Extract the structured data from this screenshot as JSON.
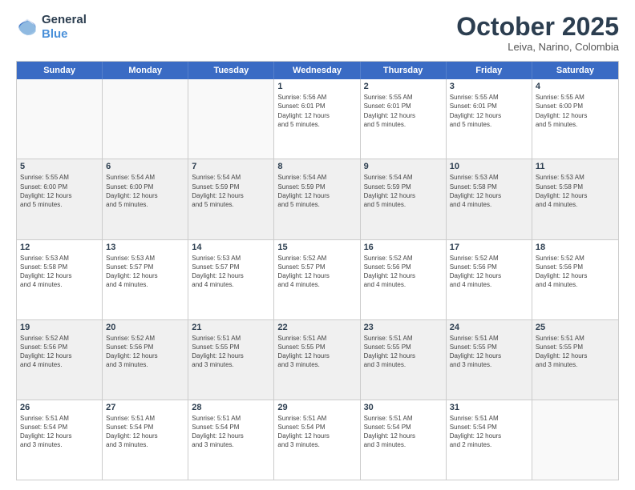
{
  "logo": {
    "line1": "General",
    "line2": "Blue"
  },
  "header": {
    "title": "October 2025",
    "subtitle": "Leiva, Narino, Colombia"
  },
  "days": [
    "Sunday",
    "Monday",
    "Tuesday",
    "Wednesday",
    "Thursday",
    "Friday",
    "Saturday"
  ],
  "rows": [
    {
      "shaded": false,
      "cells": [
        {
          "day": "",
          "info": ""
        },
        {
          "day": "",
          "info": ""
        },
        {
          "day": "",
          "info": ""
        },
        {
          "day": "1",
          "info": "Sunrise: 5:56 AM\nSunset: 6:01 PM\nDaylight: 12 hours\nand 5 minutes."
        },
        {
          "day": "2",
          "info": "Sunrise: 5:55 AM\nSunset: 6:01 PM\nDaylight: 12 hours\nand 5 minutes."
        },
        {
          "day": "3",
          "info": "Sunrise: 5:55 AM\nSunset: 6:01 PM\nDaylight: 12 hours\nand 5 minutes."
        },
        {
          "day": "4",
          "info": "Sunrise: 5:55 AM\nSunset: 6:00 PM\nDaylight: 12 hours\nand 5 minutes."
        }
      ]
    },
    {
      "shaded": true,
      "cells": [
        {
          "day": "5",
          "info": "Sunrise: 5:55 AM\nSunset: 6:00 PM\nDaylight: 12 hours\nand 5 minutes."
        },
        {
          "day": "6",
          "info": "Sunrise: 5:54 AM\nSunset: 6:00 PM\nDaylight: 12 hours\nand 5 minutes."
        },
        {
          "day": "7",
          "info": "Sunrise: 5:54 AM\nSunset: 5:59 PM\nDaylight: 12 hours\nand 5 minutes."
        },
        {
          "day": "8",
          "info": "Sunrise: 5:54 AM\nSunset: 5:59 PM\nDaylight: 12 hours\nand 5 minutes."
        },
        {
          "day": "9",
          "info": "Sunrise: 5:54 AM\nSunset: 5:59 PM\nDaylight: 12 hours\nand 5 minutes."
        },
        {
          "day": "10",
          "info": "Sunrise: 5:53 AM\nSunset: 5:58 PM\nDaylight: 12 hours\nand 4 minutes."
        },
        {
          "day": "11",
          "info": "Sunrise: 5:53 AM\nSunset: 5:58 PM\nDaylight: 12 hours\nand 4 minutes."
        }
      ]
    },
    {
      "shaded": false,
      "cells": [
        {
          "day": "12",
          "info": "Sunrise: 5:53 AM\nSunset: 5:58 PM\nDaylight: 12 hours\nand 4 minutes."
        },
        {
          "day": "13",
          "info": "Sunrise: 5:53 AM\nSunset: 5:57 PM\nDaylight: 12 hours\nand 4 minutes."
        },
        {
          "day": "14",
          "info": "Sunrise: 5:53 AM\nSunset: 5:57 PM\nDaylight: 12 hours\nand 4 minutes."
        },
        {
          "day": "15",
          "info": "Sunrise: 5:52 AM\nSunset: 5:57 PM\nDaylight: 12 hours\nand 4 minutes."
        },
        {
          "day": "16",
          "info": "Sunrise: 5:52 AM\nSunset: 5:56 PM\nDaylight: 12 hours\nand 4 minutes."
        },
        {
          "day": "17",
          "info": "Sunrise: 5:52 AM\nSunset: 5:56 PM\nDaylight: 12 hours\nand 4 minutes."
        },
        {
          "day": "18",
          "info": "Sunrise: 5:52 AM\nSunset: 5:56 PM\nDaylight: 12 hours\nand 4 minutes."
        }
      ]
    },
    {
      "shaded": true,
      "cells": [
        {
          "day": "19",
          "info": "Sunrise: 5:52 AM\nSunset: 5:56 PM\nDaylight: 12 hours\nand 4 minutes."
        },
        {
          "day": "20",
          "info": "Sunrise: 5:52 AM\nSunset: 5:56 PM\nDaylight: 12 hours\nand 3 minutes."
        },
        {
          "day": "21",
          "info": "Sunrise: 5:51 AM\nSunset: 5:55 PM\nDaylight: 12 hours\nand 3 minutes."
        },
        {
          "day": "22",
          "info": "Sunrise: 5:51 AM\nSunset: 5:55 PM\nDaylight: 12 hours\nand 3 minutes."
        },
        {
          "day": "23",
          "info": "Sunrise: 5:51 AM\nSunset: 5:55 PM\nDaylight: 12 hours\nand 3 minutes."
        },
        {
          "day": "24",
          "info": "Sunrise: 5:51 AM\nSunset: 5:55 PM\nDaylight: 12 hours\nand 3 minutes."
        },
        {
          "day": "25",
          "info": "Sunrise: 5:51 AM\nSunset: 5:55 PM\nDaylight: 12 hours\nand 3 minutes."
        }
      ]
    },
    {
      "shaded": false,
      "cells": [
        {
          "day": "26",
          "info": "Sunrise: 5:51 AM\nSunset: 5:54 PM\nDaylight: 12 hours\nand 3 minutes."
        },
        {
          "day": "27",
          "info": "Sunrise: 5:51 AM\nSunset: 5:54 PM\nDaylight: 12 hours\nand 3 minutes."
        },
        {
          "day": "28",
          "info": "Sunrise: 5:51 AM\nSunset: 5:54 PM\nDaylight: 12 hours\nand 3 minutes."
        },
        {
          "day": "29",
          "info": "Sunrise: 5:51 AM\nSunset: 5:54 PM\nDaylight: 12 hours\nand 3 minutes."
        },
        {
          "day": "30",
          "info": "Sunrise: 5:51 AM\nSunset: 5:54 PM\nDaylight: 12 hours\nand 3 minutes."
        },
        {
          "day": "31",
          "info": "Sunrise: 5:51 AM\nSunset: 5:54 PM\nDaylight: 12 hours\nand 2 minutes."
        },
        {
          "day": "",
          "info": ""
        }
      ]
    }
  ]
}
